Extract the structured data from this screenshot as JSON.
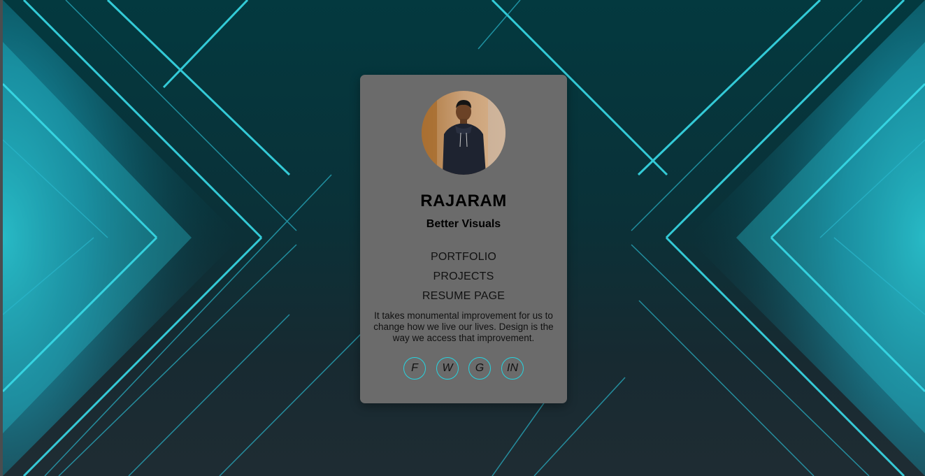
{
  "profile": {
    "name": "RAJARAM",
    "tagline": "Better Visuals"
  },
  "nav": {
    "portfolio": "PORTFOLIO",
    "projects": "PROJECTS",
    "resume": "RESUME PAGE"
  },
  "description": "It takes monumental improvement for us to change how we live our lives. Design is the way we access that improvement.",
  "socials": {
    "facebook": "F",
    "web": "W",
    "github": "G",
    "linkedin": "IN"
  },
  "colors": {
    "accent": "#27d4e0",
    "card": "#6b6b6b",
    "background": "#03393f"
  }
}
